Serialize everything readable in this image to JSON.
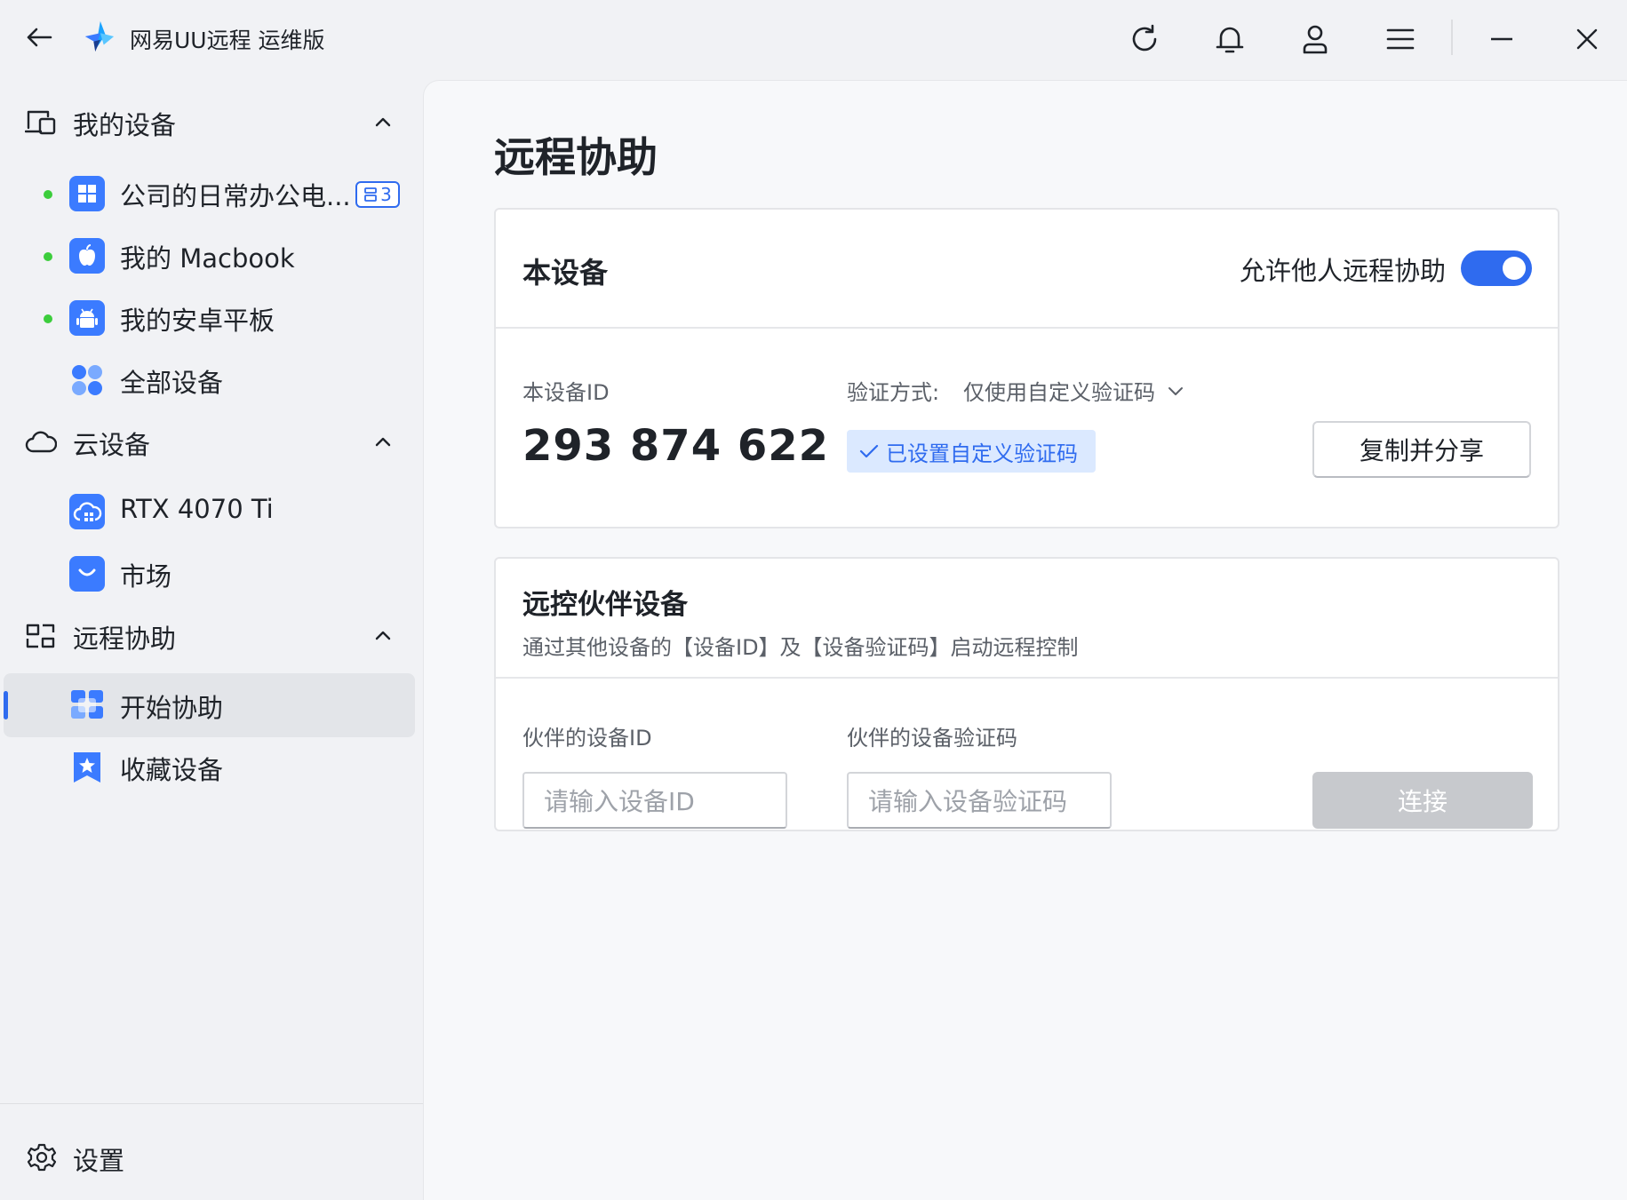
{
  "titlebar": {
    "app_name": "网易UU远程  运维版",
    "icons": [
      "back-arrow-icon",
      "app-logo-icon",
      "refresh-icon",
      "bell-icon",
      "user-icon",
      "menu-icon",
      "minimize-icon",
      "close-icon"
    ]
  },
  "sidebar": {
    "groups": [
      {
        "label": "我的设备",
        "items": [
          {
            "label": "公司的日常办公电...",
            "online": true,
            "icon": "windows-icon",
            "badge": "3"
          },
          {
            "label": "我的 Macbook",
            "online": true,
            "icon": "apple-icon"
          },
          {
            "label": "我的安卓平板",
            "online": true,
            "icon": "android-icon"
          },
          {
            "label": "全部设备",
            "online": false,
            "icon": "all-devices-icon"
          }
        ]
      },
      {
        "label": "云设备",
        "items": [
          {
            "label": "RTX 4070 Ti",
            "icon": "cloud-computer-icon"
          },
          {
            "label": "市场",
            "icon": "market-bag-icon"
          }
        ]
      },
      {
        "label": "远程协助",
        "items": [
          {
            "label": "开始协助",
            "icon": "start-assist-icon",
            "selected": true
          },
          {
            "label": "收藏设备",
            "icon": "favorite-icon"
          }
        ]
      }
    ],
    "settings_label": "设置"
  },
  "main": {
    "page_title": "远程协助",
    "this_device": {
      "title": "本设备",
      "allow_label": "允许他人远程协助",
      "allow_enabled": true,
      "id_label": "本设备ID",
      "device_id": "293 874 622",
      "verify_label": "验证方式:",
      "verify_value": "仅使用自定义验证码",
      "verify_status": "已设置自定义验证码",
      "copy_button": "复制并分享"
    },
    "partner": {
      "title": "远控伙伴设备",
      "subtitle": "通过其他设备的【设备ID】及【设备验证码】启动远程控制",
      "id_label": "伙伴的设备ID",
      "id_placeholder": "请输入设备ID",
      "code_label": "伙伴的设备验证码",
      "code_placeholder": "请输入设备验证码",
      "connect_button": "连接"
    }
  },
  "colors": {
    "accent": "#2f6bef",
    "online": "#3ccd3c",
    "disabled_button": "#c7c9cd",
    "tag_bg": "#dbe9ff"
  }
}
